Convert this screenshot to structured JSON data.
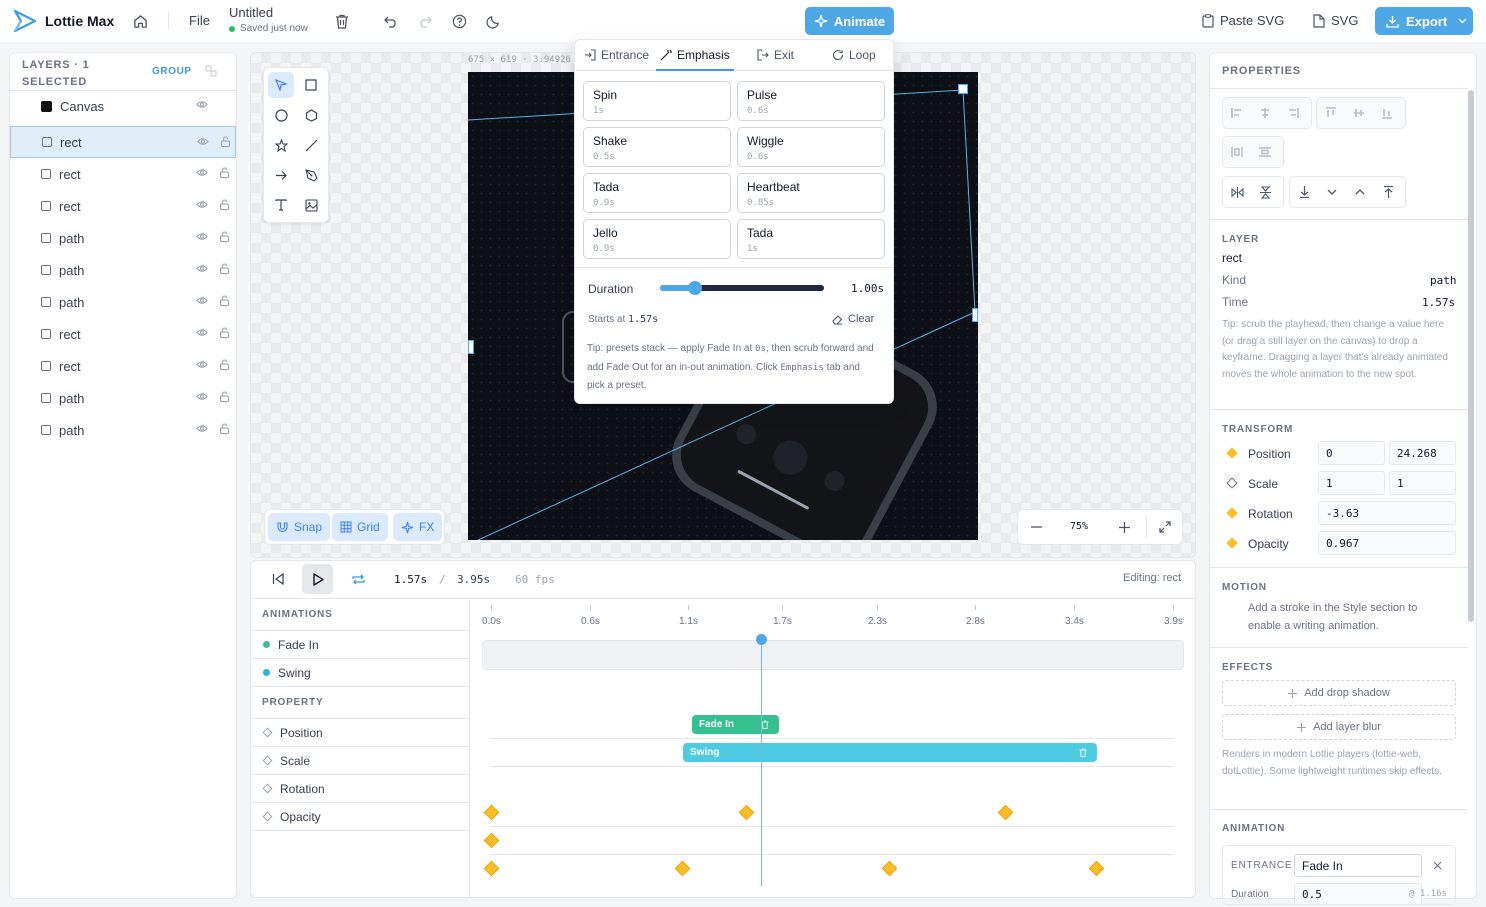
{
  "app": {
    "name": "Lottie Max",
    "file_menu": "File",
    "doc_title": "Untitled",
    "save_status": "Saved just now"
  },
  "toolbar": {
    "animate": "Animate",
    "paste_svg": "Paste SVG",
    "svg": "SVG",
    "export": "Export"
  },
  "layers": {
    "header": "LAYERS · 1 SELECTED",
    "group_label": "GROUP",
    "canvas_label": "Canvas",
    "items": [
      "rect",
      "rect",
      "rect",
      "path",
      "path",
      "path",
      "rect",
      "rect",
      "path",
      "path"
    ]
  },
  "canvas": {
    "dims": "675 × 619 · 3.94926",
    "snap": "Snap",
    "grid": "Grid",
    "fx": "FX",
    "zoom": "75%"
  },
  "popover": {
    "tabs": [
      "Entrance",
      "Emphasis",
      "Exit",
      "Loop"
    ],
    "active_tab": "Emphasis",
    "presets": [
      {
        "name": "Spin",
        "dur": "1s"
      },
      {
        "name": "Pulse",
        "dur": "0.6s"
      },
      {
        "name": "Shake",
        "dur": "0.5s"
      },
      {
        "name": "Wiggle",
        "dur": "0.6s"
      },
      {
        "name": "Tada",
        "dur": "0.9s"
      },
      {
        "name": "Heartbeat",
        "dur": "0.85s"
      },
      {
        "name": "Jello",
        "dur": "0.9s"
      },
      {
        "name": "Tada",
        "dur": "1s"
      }
    ],
    "duration_label": "Duration",
    "duration_value": "1.00s",
    "duration_fraction": 0.18,
    "starts_label": "Starts at",
    "starts_value": "1.57s",
    "clear": "Clear",
    "tip_a": "Tip: presets stack — apply Fade In at ",
    "tip_b": "0s",
    "tip_c": ", then scrub forward and add Fade Out for an in-out animation. Click ",
    "tip_d": "Emphasis",
    "tip_e": " tab and pick a preset."
  },
  "playback": {
    "current": "1.57s",
    "sep": "/",
    "total": "3.95s",
    "fps": "60 fps",
    "editing": "Editing: rect"
  },
  "timeline": {
    "animations_header": "ANIMATIONS",
    "animations": [
      {
        "name": "Fade In",
        "color": "#34c08f"
      },
      {
        "name": "Swing",
        "color": "#22b8d6"
      }
    ],
    "property_header": "PROPERTY",
    "properties": [
      "Position",
      "Scale",
      "Rotation",
      "Opacity"
    ],
    "ticks": [
      "0.0s",
      "0.6s",
      "1.1s",
      "1.7s",
      "2.3s",
      "2.8s",
      "3.4s",
      "3.9s"
    ],
    "clip_fade": "Fade In",
    "clip_swing": "Swing"
  },
  "props": {
    "header": "PROPERTIES",
    "layer_cap": "LAYER",
    "layer_name": "rect",
    "kind_label": "Kind",
    "kind_value": "path",
    "time_label": "Time",
    "time_value": "1.57s",
    "tip": "Tip: scrub the playhead, then change a value here (or drag a still layer on the canvas) to drop a keyframe. Dragging a layer that's already animated moves the whole animation to the new spot.",
    "transform_cap": "TRANSFORM",
    "position_label": "Position",
    "pos_x": "0",
    "pos_y": "24.268",
    "scale_label": "Scale",
    "scale_x": "1",
    "scale_y": "1",
    "rotation_label": "Rotation",
    "rotation": "-3.63",
    "opacity_label": "Opacity",
    "opacity": "0.967",
    "motion_cap": "MOTION",
    "motion_text": "Add a stroke in the Style section to enable a writing animation.",
    "effects_cap": "EFFECTS",
    "add_shadow": "Add drop shadow",
    "add_blur": "Add layer blur",
    "effects_note": "Renders in modern Lottie players (lottie-web, dotLottie). Some lightweight runtimes skip effects.",
    "animation_cap": "ANIMATION",
    "entrance_label": "ENTRANCE",
    "entrance_value": "Fade In",
    "duration_label": "Duration",
    "duration_value": "0.5",
    "duration_at": "@ 1.16s"
  },
  "colors": {
    "accent": "#3b9be5",
    "fade": "#34c08f",
    "swing": "#4ecbe0",
    "keyframe": "#fbbf24",
    "playhead": "#5b9bd5"
  }
}
